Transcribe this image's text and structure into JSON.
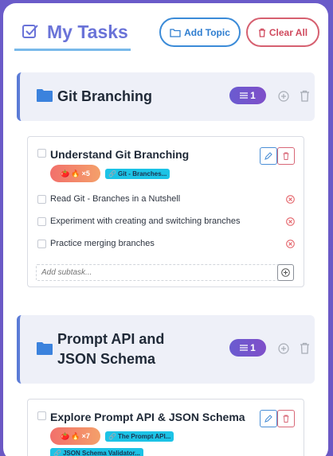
{
  "header": {
    "title": "My Tasks",
    "add_topic_label": "Add Topic",
    "clear_all_label": "Clear All"
  },
  "topics": [
    {
      "title": "Git Branching",
      "count": "1",
      "tasks": [
        {
          "title": "Understand Git Branching",
          "streak": "×5",
          "tags": [
            "Git - Branches..."
          ],
          "subtasks": [
            "Read Git - Branches in a Nutshell",
            "Experiment with creating and switching branches",
            "Practice merging branches"
          ],
          "add_subtask_placeholder": "Add subtask..."
        }
      ]
    },
    {
      "title_line1": "Prompt API and",
      "title_line2": "JSON Schema",
      "count": "1",
      "tasks": [
        {
          "title": "Explore Prompt API & JSON Schema",
          "streak": "×7",
          "tags": [
            "The Prompt API...",
            "JSON Schema Validator..."
          ]
        }
      ]
    }
  ],
  "colors": {
    "background": "#6a5bc9",
    "accent_blue": "#3b8bd8",
    "accent_red": "#d66070",
    "tag_cyan": "#1cc3e6"
  }
}
